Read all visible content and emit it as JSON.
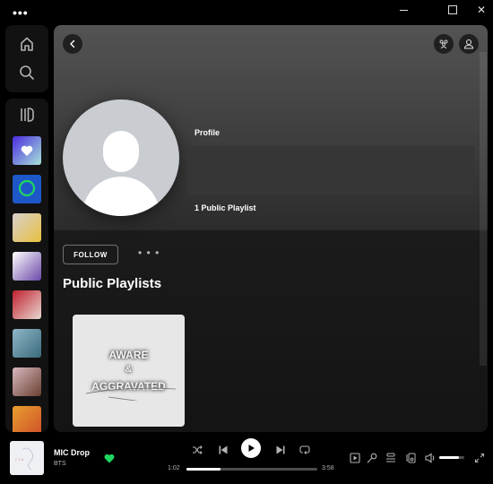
{
  "window": {
    "menu_label": "•••",
    "controls": [
      "minimize",
      "maximize",
      "close"
    ]
  },
  "nav": {
    "items": [
      {
        "icon": "home-icon",
        "label": "Home"
      },
      {
        "icon": "search-icon",
        "label": "Search"
      }
    ],
    "library_icon": "library-icon",
    "library_items": [
      {
        "name": "Liked Songs",
        "colors": [
          "#4b2be0",
          "#a7e4d8"
        ]
      },
      {
        "name": "Playlist blue",
        "colors": [
          "#1e58c8",
          "#1e58c8"
        ]
      },
      {
        "name": "Mix collage",
        "colors": [
          "#d8d0cc",
          "#e8c040"
        ]
      },
      {
        "name": "BTS playlist",
        "colors": [
          "#ffffff",
          "#6a48a8"
        ]
      },
      {
        "name": "Red hat album",
        "colors": [
          "#c02030",
          "#e8d8d0"
        ]
      },
      {
        "name": "Ocean album",
        "colors": [
          "#8fb8c8",
          "#3a6a7a"
        ]
      },
      {
        "name": "Taylor collage",
        "colors": [
          "#d8b8c0",
          "#6a4030"
        ]
      },
      {
        "name": "Orange album",
        "colors": [
          "#e8a030",
          "#d05028"
        ]
      }
    ]
  },
  "main": {
    "profile_type": "Profile",
    "display_name": "",
    "stats": "1 Public Playlist",
    "follow_label": "FOLLOW",
    "more_label": "• • •",
    "section_title": "Public Playlists",
    "playlists": [
      {
        "title_line1": "AWARE",
        "title_line2": "&",
        "title_line3": "AGGRAVATED"
      }
    ]
  },
  "player": {
    "track_title": "MIC Drop",
    "artist": "BTS",
    "liked": true,
    "current_time": "1:02",
    "total_time": "3:58",
    "progress_fraction": 0.26,
    "volume_fraction": 0.8,
    "accent_color": "#1ed760"
  }
}
